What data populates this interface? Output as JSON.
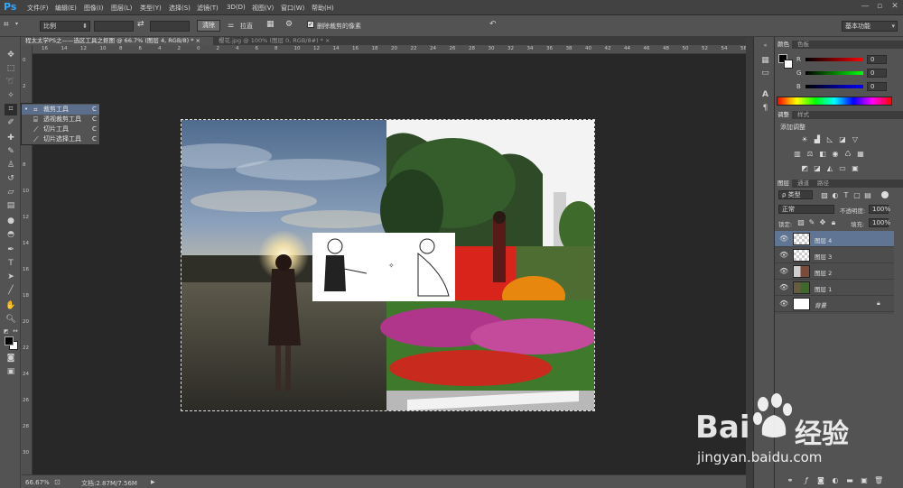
{
  "app": {
    "logo": "Ps"
  },
  "menu": [
    "文件(F)",
    "编辑(E)",
    "图像(I)",
    "图层(L)",
    "类型(Y)",
    "选择(S)",
    "滤镜(T)",
    "3D(D)",
    "视图(V)",
    "窗口(W)",
    "帮助(H)"
  ],
  "window_controls": {
    "minimize": "—",
    "restore": "▫",
    "close": "✕"
  },
  "options": {
    "ratio_value": "比例",
    "swap_glyph": "⇄",
    "clear_button": "清除",
    "straighten_label": "拉直",
    "delete_cropped_label": "删除裁剪的像素",
    "reset_glyph": "↶",
    "workspace_value": "基本功能"
  },
  "doc_tabs": [
    {
      "label": "程太太学PS之——选区工具之抠图 @ 66.7% (图层 4, RGB/8) *",
      "close": "×",
      "active": true
    },
    {
      "label": "樱花.jpg @ 100% (图层 0, RGB/8#) *",
      "close": "×",
      "active": false
    }
  ],
  "ruler_top": [
    "16",
    "14",
    "12",
    "10",
    "8",
    "6",
    "4",
    "2",
    "0",
    "2",
    "4",
    "6",
    "8",
    "10",
    "12",
    "14",
    "16",
    "18",
    "20",
    "22",
    "24",
    "26",
    "28",
    "30",
    "32",
    "34",
    "36",
    "38",
    "40",
    "42",
    "44",
    "46",
    "48",
    "50",
    "52",
    "54",
    "56"
  ],
  "ruler_left": [
    "0",
    "2",
    "4",
    "6",
    "8",
    "10",
    "12",
    "14",
    "16",
    "18",
    "20",
    "22",
    "24",
    "26",
    "28",
    "30"
  ],
  "flyout": [
    {
      "icon": "crop-icon",
      "glyph": "⌗",
      "label": "裁剪工具",
      "key": "C",
      "bullet": "•"
    },
    {
      "icon": "perspective-crop-icon",
      "glyph": "⌸",
      "label": "透视裁剪工具",
      "key": "C"
    },
    {
      "icon": "slice-icon",
      "glyph": "⟋",
      "label": "切片工具",
      "key": "C"
    },
    {
      "icon": "slice-select-icon",
      "glyph": "⟋",
      "label": "切片选择工具",
      "key": "C"
    }
  ],
  "status": {
    "zoom": "66.67%",
    "doc_info": "文档:2.87M/7.56M",
    "arrow": "▶"
  },
  "panels": {
    "color_tabs": [
      "颜色",
      "色板"
    ],
    "rgb": [
      {
        "label": "R",
        "value": "0"
      },
      {
        "label": "G",
        "value": "0"
      },
      {
        "label": "B",
        "value": "0"
      }
    ],
    "adjust_tabs": [
      "调整",
      "样式"
    ],
    "adjust_title": "添加调整",
    "layers_tabs": [
      "图层",
      "通道",
      "路径"
    ],
    "kind_filter": "ρ 类型",
    "blend_mode": "正常",
    "opacity_label": "不透明度:",
    "opacity_value": "100%",
    "lock_label": "锁定:",
    "fill_label": "填充:",
    "fill_value": "100%",
    "layers": [
      {
        "name": "图层 4",
        "selected": true
      },
      {
        "name": "图层 3",
        "selected": false
      },
      {
        "name": "图层 2",
        "selected": false
      },
      {
        "name": "图层 1",
        "selected": false
      },
      {
        "name": "背景",
        "selected": false,
        "italic": true,
        "lock": "🔒"
      }
    ]
  },
  "watermark": {
    "brand_left": "Bai",
    "brand_right": "经验",
    "url": "jingyan.baidu.com"
  }
}
